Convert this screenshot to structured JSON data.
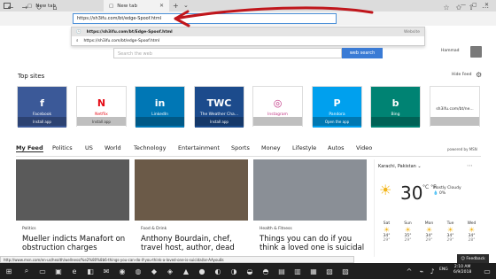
{
  "tabs": [
    {
      "label": "New tab"
    },
    {
      "label": "New tab"
    }
  ],
  "address_value": "https://sh3ifu.com/bt/edge-Spoof.html",
  "suggestions": [
    {
      "text": "https://sh3ifu.com/bt/Edge-Spoof.html",
      "tag": "Website"
    },
    {
      "text": "https://sh3ifu.com/bt/edge-Spoof.html",
      "tag": ""
    }
  ],
  "search_placeholder": "Search the web",
  "search_button": "web search",
  "user_name": "Hammad",
  "top_sites_title": "Top sites",
  "hide_feed": "Hide Feed",
  "tiles": [
    {
      "logo": "f",
      "label": "Facebook",
      "sub": "Install app",
      "bg": "#3b5998"
    },
    {
      "logo": "N",
      "label": "Netflix",
      "sub": "Install app",
      "bg": "#ffffff",
      "fg": "#e50914"
    },
    {
      "logo": "in",
      "label": "LinkedIn",
      "sub": "",
      "bg": "#0077b5"
    },
    {
      "logo": "TWC",
      "label": "The Weather Cha...",
      "sub": "Install app",
      "bg": "#1c4b8c"
    },
    {
      "logo": "◎",
      "label": "Instagram",
      "sub": "",
      "bg": "#ffffff",
      "fg": "#c13584"
    },
    {
      "logo": "P",
      "label": "Pandora",
      "sub": "Open the app",
      "bg": "#00a0ee"
    },
    {
      "logo": "b",
      "label": "Bing",
      "sub": "",
      "bg": "#008373"
    },
    {
      "logo": "",
      "label": "sh3ifu.com/bt/ne...",
      "sub": "",
      "bg": "#ffffff",
      "fg": "#333"
    }
  ],
  "feed_tabs": [
    "My Feed",
    "Politics",
    "US",
    "World",
    "Technology",
    "Entertainment",
    "Sports",
    "Money",
    "Lifestyle",
    "Autos",
    "Video"
  ],
  "powered_by": "powered by MSN",
  "cards": [
    {
      "cat": "Politics",
      "headline": "Mueller indicts Manafort on obstruction charges",
      "img": "#5e5e5e"
    },
    {
      "cat": "Food & Drink",
      "headline": "Anthony Bourdain, chef, travel host, author, dead",
      "img": "#6b5a48"
    },
    {
      "cat": "Health & Fitness",
      "headline": "Things you can do if you think a loved one is suicidal",
      "img": "#8a8f96"
    }
  ],
  "weather": {
    "location": "Karachi, Pakistan",
    "temp": "30",
    "unit": "°C °F",
    "condition": "Mostly Cloudy",
    "precip": "0%",
    "forecast": [
      {
        "day": "Sat",
        "hi": "34°",
        "lo": "29°"
      },
      {
        "day": "Sun",
        "hi": "35°",
        "lo": "29°"
      },
      {
        "day": "Mon",
        "hi": "34°",
        "lo": "29°"
      },
      {
        "day": "Tue",
        "hi": "34°",
        "lo": "29°"
      },
      {
        "day": "Wed",
        "hi": "34°",
        "lo": "28°"
      }
    ]
  },
  "status_url": "http://www.msn.com/en-us/health/wellness/%e2%80%8b6-things-you-can-do-if-you-think-a-loved-one-is-suicidal/ar-AAyou8s",
  "feedback": "Feedback",
  "lang": "ENG",
  "time": "2:10 AM",
  "date": "6/9/2018",
  "colors": {
    "accent": "#3a7bd5",
    "annotation": "#c0161c"
  }
}
